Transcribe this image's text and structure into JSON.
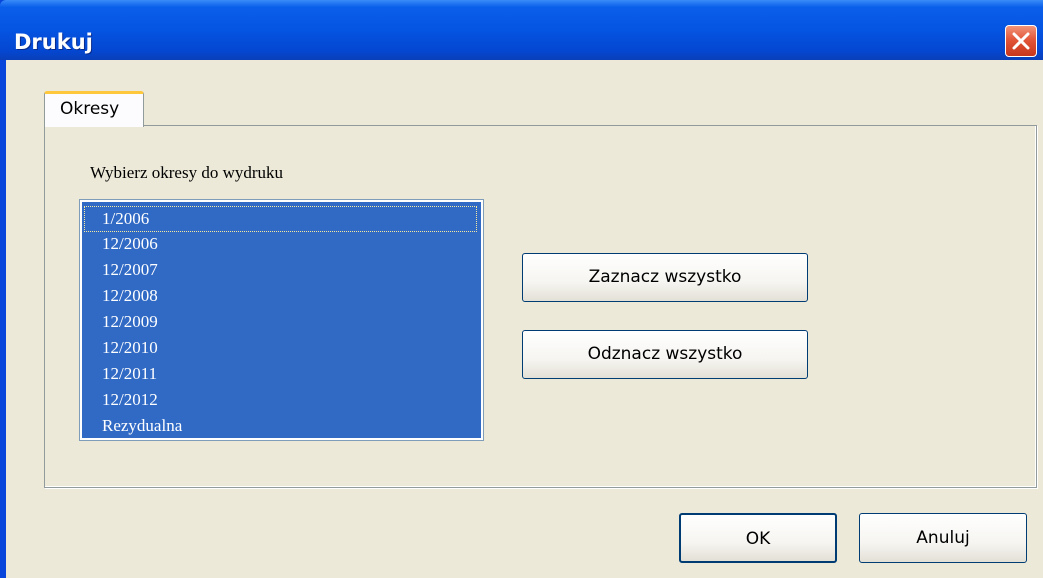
{
  "window": {
    "title": "Drukuj"
  },
  "tabs": [
    {
      "label": "Okresy",
      "active": true
    }
  ],
  "panel": {
    "label": "Wybierz okresy do wydruku",
    "periods": [
      "1/2006",
      "12/2006",
      "12/2007",
      "12/2008",
      "12/2009",
      "12/2010",
      "12/2011",
      "12/2012",
      "Rezydualna"
    ],
    "selected": "all",
    "focused_index": 0
  },
  "buttons": {
    "select_all": "Zaznacz wszystko",
    "deselect_all": "Odznacz wszystko",
    "ok": "OK",
    "cancel": "Anuluj"
  },
  "colors": {
    "titlebar": "#0554E2",
    "selection": "#316AC5",
    "dialog_bg": "#ECE9D8",
    "close_button": "#E2563A"
  }
}
